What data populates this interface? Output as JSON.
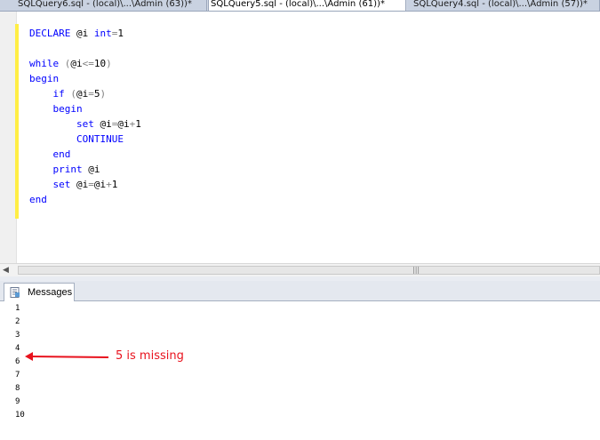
{
  "tabs": [
    {
      "label": "SQLQuery6.sql - (local)\\...\\Admin (63))*",
      "active": false
    },
    {
      "label": "SQLQuery5.sql - (local)\\...\\Admin (61))*",
      "active": true
    },
    {
      "label": "SQLQuery4.sql - (local)\\...\\Admin (57))*",
      "active": false
    }
  ],
  "editor": {
    "code_lines": [
      [
        {
          "t": "DECLARE",
          "c": "kw"
        },
        {
          "t": " @i ",
          "c": "tx"
        },
        {
          "t": "int",
          "c": "kw"
        },
        {
          "t": "=",
          "c": "op"
        },
        {
          "t": "1",
          "c": "tx"
        }
      ],
      [],
      [
        {
          "t": "while",
          "c": "kw"
        },
        {
          "t": " (",
          "c": "op"
        },
        {
          "t": "@i",
          "c": "tx"
        },
        {
          "t": "<=",
          "c": "op"
        },
        {
          "t": "10",
          "c": "tx"
        },
        {
          "t": ")",
          "c": "op"
        }
      ],
      [
        {
          "t": "begin",
          "c": "kw"
        }
      ],
      [
        {
          "t": "    ",
          "c": "tx"
        },
        {
          "t": "if",
          "c": "kw"
        },
        {
          "t": " (",
          "c": "op"
        },
        {
          "t": "@i",
          "c": "tx"
        },
        {
          "t": "=",
          "c": "op"
        },
        {
          "t": "5",
          "c": "tx"
        },
        {
          "t": ")",
          "c": "op"
        }
      ],
      [
        {
          "t": "    ",
          "c": "tx"
        },
        {
          "t": "begin",
          "c": "kw"
        }
      ],
      [
        {
          "t": "        ",
          "c": "tx"
        },
        {
          "t": "set",
          "c": "kw"
        },
        {
          "t": " @i",
          "c": "tx"
        },
        {
          "t": "=",
          "c": "op"
        },
        {
          "t": "@i",
          "c": "tx"
        },
        {
          "t": "+",
          "c": "op"
        },
        {
          "t": "1",
          "c": "tx"
        }
      ],
      [
        {
          "t": "        ",
          "c": "tx"
        },
        {
          "t": "CONTINUE",
          "c": "kw"
        }
      ],
      [
        {
          "t": "    ",
          "c": "tx"
        },
        {
          "t": "end",
          "c": "kw"
        }
      ],
      [
        {
          "t": "    ",
          "c": "tx"
        },
        {
          "t": "print",
          "c": "kw"
        },
        {
          "t": " @i",
          "c": "tx"
        }
      ],
      [
        {
          "t": "    ",
          "c": "tx"
        },
        {
          "t": "set",
          "c": "kw"
        },
        {
          "t": " @i",
          "c": "tx"
        },
        {
          "t": "=",
          "c": "op"
        },
        {
          "t": "@i",
          "c": "tx"
        },
        {
          "t": "+",
          "c": "op"
        },
        {
          "t": "1",
          "c": "tx"
        }
      ],
      [
        {
          "t": "end",
          "c": "kw"
        }
      ]
    ]
  },
  "results": {
    "tab_label": "Messages",
    "tab_icon": "messages-icon",
    "output": [
      "1",
      "2",
      "3",
      "4",
      "6",
      "7",
      "8",
      "9",
      "10"
    ]
  },
  "annotation": {
    "text": "5 is missing",
    "color": "#e8121d"
  },
  "colors": {
    "keyword": "#0000ff",
    "operator": "#808080",
    "change_bar": "#ffee45"
  }
}
